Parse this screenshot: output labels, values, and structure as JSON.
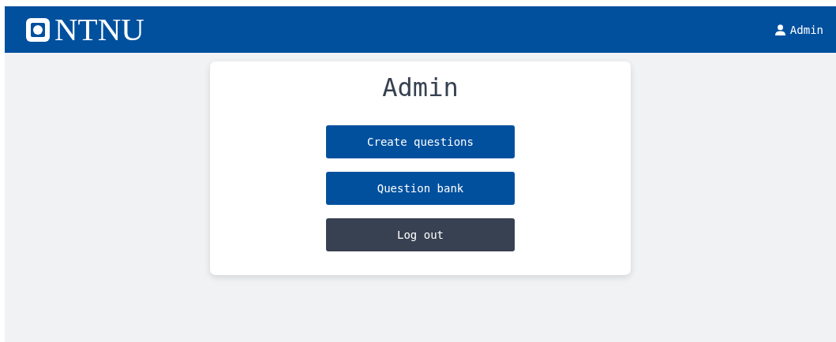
{
  "header": {
    "logo_text": "NTNU",
    "user": "Admin"
  },
  "card": {
    "title": "Admin",
    "buttons": [
      {
        "label": "Create questions",
        "kind": "primary"
      },
      {
        "label": "Question bank",
        "kind": "primary"
      },
      {
        "label": "Log out",
        "kind": "secondary"
      }
    ]
  }
}
